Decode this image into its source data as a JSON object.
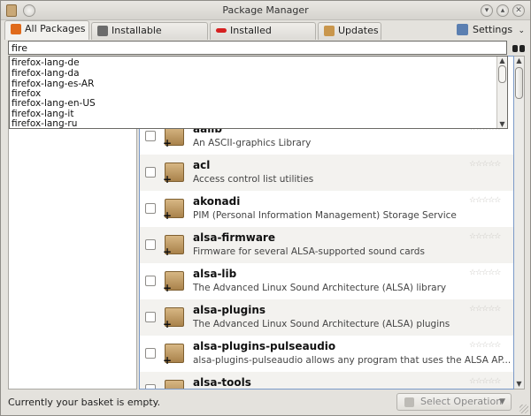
{
  "window": {
    "title": "Package Manager"
  },
  "tabs": [
    {
      "label": "All Packages",
      "color": "#e06a1b",
      "active": true
    },
    {
      "label": "Installable Packages",
      "color": "#6b6b6b",
      "active": false
    },
    {
      "label": "Installed Packages",
      "color": "#d62020",
      "active": false
    },
    {
      "label": "Updates",
      "color": "#c9964c",
      "active": false
    }
  ],
  "settings": {
    "label": "Settings"
  },
  "search": {
    "value": "fire"
  },
  "suggestions": [
    "firefox-lang-de",
    "firefox-lang-da",
    "firefox-lang-es-AR",
    "firefox",
    "firefox-lang-en-US",
    "firefox-lang-it",
    "firefox-lang-ru"
  ],
  "packages": [
    {
      "name": "aalib",
      "desc": "An ASCII-graphics Library"
    },
    {
      "name": "acl",
      "desc": "Access control list utilities"
    },
    {
      "name": "akonadi",
      "desc": "PIM (Personal Information Management) Storage Service"
    },
    {
      "name": "alsa-firmware",
      "desc": "Firmware for several ALSA-supported sound cards"
    },
    {
      "name": "alsa-lib",
      "desc": "The Advanced Linux Sound Architecture (ALSA) library"
    },
    {
      "name": "alsa-plugins",
      "desc": "The Advanced Linux Sound Architecture (ALSA) plugins"
    },
    {
      "name": "alsa-plugins-pulseaudio",
      "desc": "alsa-plugins-pulseaudio allows any program that uses the ALSA AP..."
    },
    {
      "name": "alsa-tools",
      "desc": ""
    }
  ],
  "rating_glyphs": "☆☆☆☆☆",
  "status": {
    "text": "Currently your basket is empty."
  },
  "select_operation": {
    "label": "Select Operation"
  }
}
